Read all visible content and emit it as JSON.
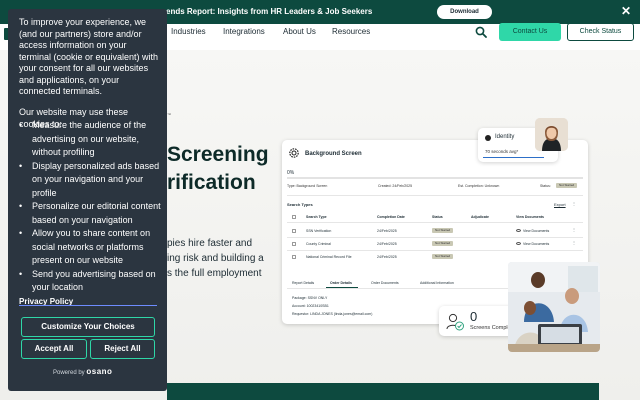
{
  "announcement": {
    "text": "ends Report: Insights from HR Leaders & Job Seekers",
    "download_label": "Download",
    "close_glyph": "✕"
  },
  "nav": {
    "items": [
      "Industries",
      "Integrations",
      "About Us",
      "Resources"
    ],
    "contact_label": "Contact Us",
    "check_status_label": "Check Status"
  },
  "hero": {
    "trademark": "™",
    "title_line1": "Screening",
    "title_line2": "rification",
    "para_line1": "pies hire faster and",
    "para_line2": "ing risk and building a",
    "para_line3": "s the full employment"
  },
  "screen_card": {
    "title": "Background Screen",
    "progress_text": "0%",
    "progress_fraction": 0.0,
    "type_label": "Type:",
    "type_value": "Background Screen",
    "created_label": "Created:",
    "created_value": "24/Feb/2025",
    "est_label": "Est. Completion:",
    "est_value": "Unknown",
    "status_label": "Status:",
    "status_value": "Not Started",
    "search_types_title": "Search Types",
    "export_label": "Export",
    "columns": [
      "Search Type",
      "Completion Date",
      "Status",
      "Adjudicate",
      "View Documents"
    ],
    "rows": [
      {
        "type": "SSN Verification",
        "date": "24/Feb/2025",
        "status": "Not Started",
        "docs": "View Documents"
      },
      {
        "type": "County Criminal",
        "date": "24/Feb/2025",
        "status": "Not Started",
        "docs": "View Documents"
      },
      {
        "type": "National Criminal Record File",
        "date": "24/Feb/2025",
        "status": "Not Started",
        "docs": ""
      }
    ],
    "tabs": [
      "Report Details",
      "Order Details",
      "Order Documents",
      "Additional Information"
    ],
    "active_tab": "Order Details",
    "details": [
      "Package: SSNV ONLY",
      "Account: 10023410SB1",
      "Requestor: LINDA JONES (linda.jones@email.com)"
    ]
  },
  "identity": {
    "label": "Identity",
    "seconds": "70 seconds avg*"
  },
  "screens_completed": {
    "count": "0",
    "label": "Screens Completed"
  },
  "cookie": {
    "intro": "To improve your experience, we (and our partners) store and/or access information on your terminal (cookie or equivalent) with your consent for all our websites and applications, on your connected terminals.",
    "subheading": "Our website may use these cookies to:",
    "bullets": [
      "Measure the audience of the advertising on our website, without profiling",
      "Display personalized ads based on your navigation and your profile",
      "Personalize our editorial content based on your navigation",
      "Allow you to share content on social networks or platforms present on our website",
      "Send you advertising based on your location"
    ],
    "privacy_policy": "Privacy Policy",
    "customize_label": "Customize Your Choices",
    "accept_label": "Accept All",
    "reject_label": "Reject All",
    "powered_by": "Powered by",
    "brand": "osano"
  }
}
